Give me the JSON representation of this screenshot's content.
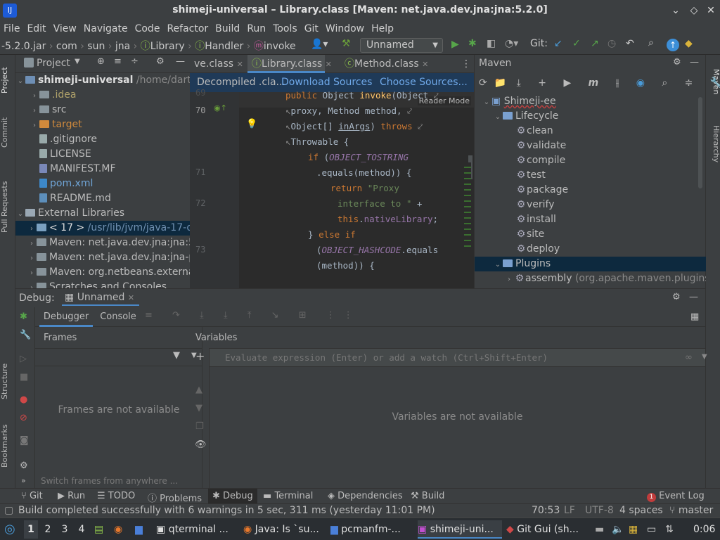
{
  "window": {
    "title": "shimeji-universal – Library.class [Maven: net.java.dev.jna:jna:5.2.0]",
    "app_icon": "IJ"
  },
  "menu": [
    "File",
    "Edit",
    "View",
    "Navigate",
    "Code",
    "Refactor",
    "Build",
    "Run",
    "Tools",
    "Git",
    "Window",
    "Help"
  ],
  "nav": {
    "crumbs": [
      "-5.2.0.jar",
      "com",
      "sun",
      "jna",
      "Library",
      "Handler",
      "invoke"
    ],
    "run_config": "Unnamed",
    "git_label": "Git:"
  },
  "project": {
    "title": "Project",
    "root": {
      "name": "shimeji-universal",
      "path": "/home/dartz"
    },
    "items": [
      ".idea",
      "src",
      "target",
      ".gitignore",
      "LICENSE",
      "MANIFEST.MF",
      "pom.xml",
      "README.md"
    ],
    "external": "External Libraries",
    "libs": [
      {
        "label": "< 17 >",
        "path": "/usr/lib/jvm/java-17-o"
      },
      {
        "label": "Maven: net.java.dev.jna:jna:5"
      },
      {
        "label": "Maven: net.java.dev.jna:jna-p"
      },
      {
        "label": "Maven: org.netbeans.externa"
      }
    ],
    "scratches": "Scratches and Consoles"
  },
  "editor": {
    "tabs": [
      "ve.class",
      "Library.class",
      "Method.class"
    ],
    "banner": {
      "text": "Decompiled .cla...",
      "download": "Download Sources",
      "choose": "Choose Sources..."
    },
    "reader_mode": "Reader Mode",
    "line_numbers": {
      "l69": "69",
      "l70": "70",
      "l71": "71",
      "l72": "72",
      "l73": "73"
    }
  },
  "maven": {
    "title": "Maven",
    "project": "Shimeji-ee",
    "lifecycle": "Lifecycle",
    "phases": [
      "clean",
      "validate",
      "compile",
      "test",
      "package",
      "verify",
      "install",
      "site",
      "deploy"
    ],
    "plugins": "Plugins",
    "plugin_item": "assembly",
    "plugin_item_detail": "(org.apache.maven.plugins:"
  },
  "debug": {
    "label": "Debug:",
    "config": "Unnamed",
    "tabs": [
      "Debugger",
      "Console"
    ],
    "frames_title": "Frames",
    "frames_empty": "Frames are not available",
    "frames_hint": "Switch frames from anywhere ...",
    "variables_title": "Variables",
    "eval_placeholder": "Evaluate expression (Enter) or add a watch (Ctrl+Shift+Enter)",
    "variables_empty": "Variables are not available"
  },
  "tool_windows": {
    "bottom": [
      "Git",
      "Run",
      "TODO",
      "Problems",
      "Debug",
      "Terminal",
      "Dependencies",
      "Build"
    ],
    "event_log": "Event Log",
    "event_count": "1",
    "left": [
      "Project",
      "Commit",
      "Pull Requests",
      "Structure",
      "Bookmarks"
    ],
    "right": [
      "Maven",
      "Hierarchy"
    ]
  },
  "status": {
    "message": "Build completed successfully with 6 warnings in 5 sec, 311 ms (yesterday 11:01 PM)",
    "position": "70:53",
    "line_sep": "LF",
    "encoding": "UTF-8",
    "indent": "4 spaces",
    "branch": "master"
  },
  "taskbar": {
    "workspaces": [
      "1",
      "2",
      "3",
      "4"
    ],
    "windows": [
      "qterminal ...",
      "Java: Is `su...",
      "pcmanfm-...",
      "shimeji-uni...",
      "Git Gui (sh..."
    ],
    "clock": "0:06"
  },
  "colors": {
    "accent": "#4a88c7",
    "selection": "#0d293e",
    "banner": "#1f3a58",
    "keyword": "#cc7832",
    "string": "#6a8759"
  }
}
